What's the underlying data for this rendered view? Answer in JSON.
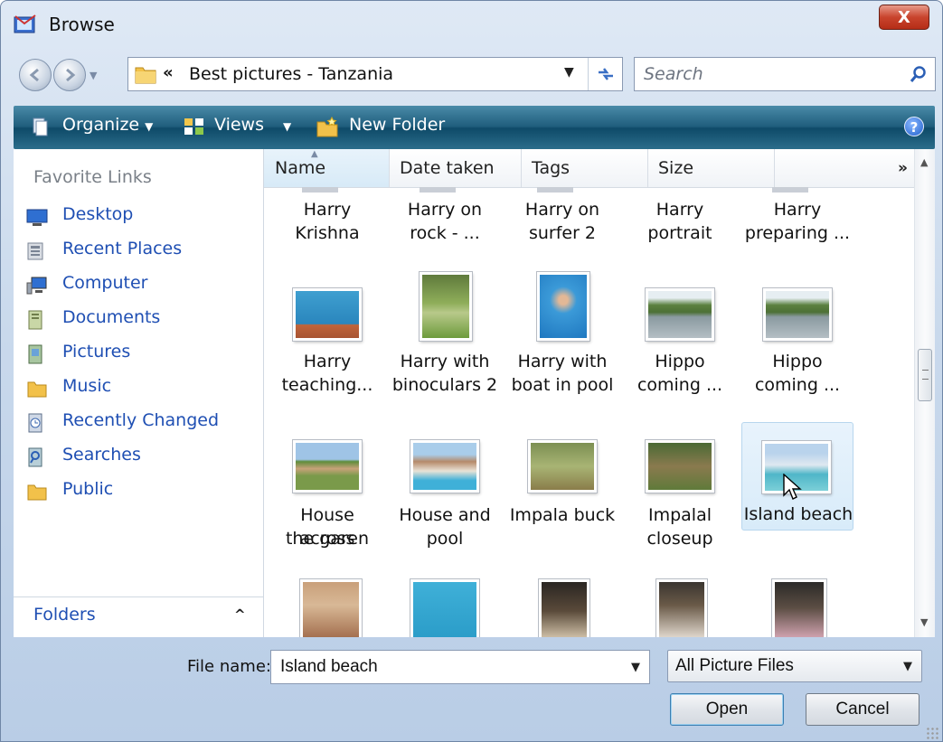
{
  "window": {
    "title": "Browse",
    "close_label": "X"
  },
  "address": {
    "chevron": "«",
    "path": "Best pictures - Tanzania",
    "search_placeholder": "Search"
  },
  "toolbar": {
    "organize": "Organize",
    "views": "Views",
    "new_folder": "New Folder",
    "help": "?"
  },
  "nav": {
    "favorite_title": "Favorite Links",
    "items": [
      {
        "label": "Desktop",
        "icon": "desktop-icon"
      },
      {
        "label": "Recent Places",
        "icon": "recent-places-icon"
      },
      {
        "label": "Computer",
        "icon": "computer-icon"
      },
      {
        "label": "Documents",
        "icon": "documents-icon"
      },
      {
        "label": "Pictures",
        "icon": "pictures-icon"
      },
      {
        "label": "Music",
        "icon": "music-folder-icon"
      },
      {
        "label": "Recently Changed",
        "icon": "recently-changed-icon"
      },
      {
        "label": "Searches",
        "icon": "searches-icon"
      },
      {
        "label": "Public",
        "icon": "public-folder-icon"
      }
    ],
    "folders_label": "Folders"
  },
  "columns": {
    "name": "Name",
    "date_taken": "Date taken",
    "tags": "Tags",
    "size": "Size",
    "more": "»"
  },
  "files": {
    "row0": [
      {
        "l1": "Harry Krishna",
        "l2": ""
      },
      {
        "l1": "Harry on",
        "l2": "rock - ..."
      },
      {
        "l1": "Harry on",
        "l2": "surfer 2"
      },
      {
        "l1": "Harry portrait",
        "l2": ""
      },
      {
        "l1": "Harry",
        "l2": "preparing ..."
      }
    ],
    "row1": [
      {
        "l1": "Harry",
        "l2": "teaching..."
      },
      {
        "l1": "Harry with",
        "l2": "binoculars 2"
      },
      {
        "l1": "Harry with",
        "l2": "boat in pool"
      },
      {
        "l1": "Hippo",
        "l2": "coming ..."
      },
      {
        "l1": "Hippo",
        "l2": "coming ..."
      }
    ],
    "row2": [
      {
        "l1": "House across",
        "l2": "the garen"
      },
      {
        "l1": "House and",
        "l2": "pool"
      },
      {
        "l1": "Impala buck",
        "l2": ""
      },
      {
        "l1": "Impalal",
        "l2": "closeup"
      },
      {
        "l1": "Island beach",
        "l2": ""
      }
    ]
  },
  "selected_file": "Island beach",
  "bottom": {
    "file_name_label": "File name:",
    "file_name_value": "Island beach",
    "filter_value": "All Picture Files",
    "open_label": "Open",
    "cancel_label": "Cancel"
  },
  "colors": {
    "link_blue": "#1f4fb3",
    "toolbar_teal": "#1f5d7c",
    "selection": "#d8ebf9"
  }
}
